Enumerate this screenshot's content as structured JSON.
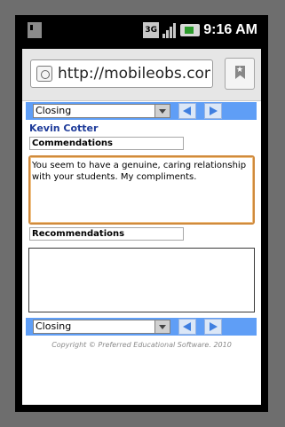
{
  "status_bar": {
    "network": "3G",
    "time": "9:16 AM"
  },
  "browser": {
    "url": "http://mobileobs.com..."
  },
  "top_nav": {
    "selected": "Closing"
  },
  "teacher": {
    "name": "Kevin Cotter"
  },
  "commendations": {
    "label": "Commendations",
    "text": "You seem to have a genuine, caring relationship with your students.  My compliments."
  },
  "recommendations": {
    "label": "Recommendations",
    "text": ""
  },
  "bottom_nav": {
    "selected": "Closing"
  },
  "footer": {
    "copyright": "Copyright © Preferred Educational Software. 2010"
  },
  "colors": {
    "nav_bar": "#5f9ef6",
    "teacher_name": "#1f3c9a",
    "focus_border": "#d08a3c"
  }
}
